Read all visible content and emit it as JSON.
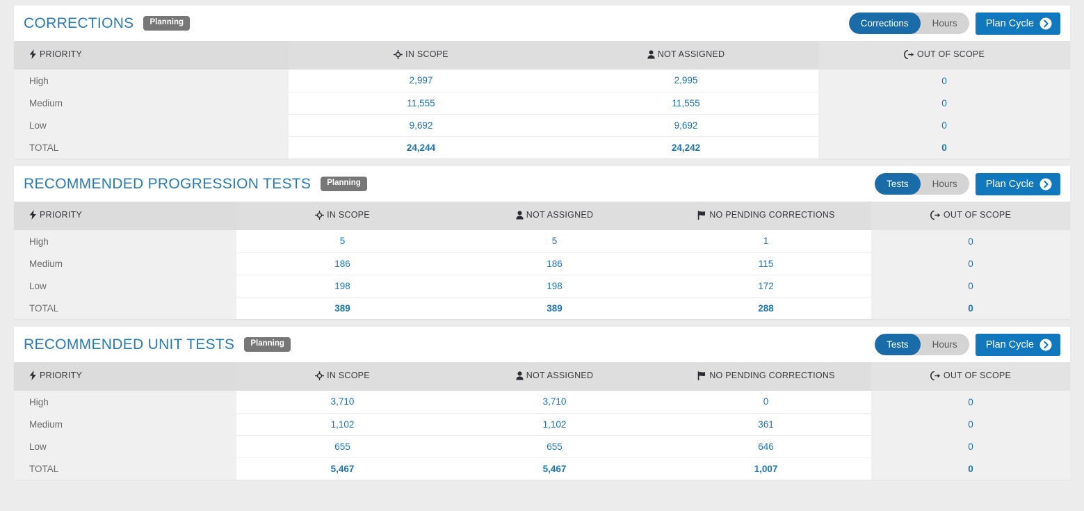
{
  "page": {
    "background_color": "#ececec",
    "accent_blue": "#1278bd",
    "title_blue": "#2a7ab5",
    "value_blue": "#1d73b3",
    "badge_gray": "#777777"
  },
  "column_icons": {
    "priority": "lightning-bolt-icon",
    "in_scope": "crosshair-target-icon",
    "not_assigned": "person-icon",
    "no_pending_corrections": "flag-icon",
    "out_of_scope": "sign-out-icon"
  },
  "sections": [
    {
      "id": "corrections",
      "title": "CORRECTIONS",
      "badge": "Planning",
      "toggle": {
        "options": [
          "Corrections",
          "Hours"
        ],
        "selected": "Corrections"
      },
      "plan_button": "Plan Cycle",
      "columns": [
        "PRIORITY",
        "IN SCOPE",
        "NOT ASSIGNED",
        "OUT OF SCOPE"
      ],
      "rows": [
        {
          "priority": "High",
          "values": [
            "2,997",
            "2,995",
            "0"
          ]
        },
        {
          "priority": "Medium",
          "values": [
            "11,555",
            "11,555",
            "0"
          ]
        },
        {
          "priority": "Low",
          "values": [
            "9,692",
            "9,692",
            "0"
          ]
        },
        {
          "priority": "TOTAL",
          "values": [
            "24,244",
            "24,242",
            "0"
          ]
        }
      ]
    },
    {
      "id": "recommended-progression-tests",
      "title": "RECOMMENDED PROGRESSION TESTS",
      "badge": "Planning",
      "toggle": {
        "options": [
          "Tests",
          "Hours"
        ],
        "selected": "Tests"
      },
      "plan_button": "Plan Cycle",
      "columns": [
        "PRIORITY",
        "IN SCOPE",
        "NOT ASSIGNED",
        "NO PENDING CORRECTIONS",
        "OUT OF SCOPE"
      ],
      "rows": [
        {
          "priority": "High",
          "values": [
            "5",
            "5",
            "1",
            "0"
          ]
        },
        {
          "priority": "Medium",
          "values": [
            "186",
            "186",
            "115",
            "0"
          ]
        },
        {
          "priority": "Low",
          "values": [
            "198",
            "198",
            "172",
            "0"
          ]
        },
        {
          "priority": "TOTAL",
          "values": [
            "389",
            "389",
            "288",
            "0"
          ]
        }
      ]
    },
    {
      "id": "recommended-unit-tests",
      "title": "RECOMMENDED UNIT TESTS",
      "badge": "Planning",
      "toggle": {
        "options": [
          "Tests",
          "Hours"
        ],
        "selected": "Tests"
      },
      "plan_button": "Plan Cycle",
      "columns": [
        "PRIORITY",
        "IN SCOPE",
        "NOT ASSIGNED",
        "NO PENDING CORRECTIONS",
        "OUT OF SCOPE"
      ],
      "rows": [
        {
          "priority": "High",
          "values": [
            "3,710",
            "3,710",
            "0",
            "0"
          ]
        },
        {
          "priority": "Medium",
          "values": [
            "1,102",
            "1,102",
            "361",
            "0"
          ]
        },
        {
          "priority": "Low",
          "values": [
            "655",
            "655",
            "646",
            "0"
          ]
        },
        {
          "priority": "TOTAL",
          "values": [
            "5,467",
            "5,467",
            "1,007",
            "0"
          ]
        }
      ]
    }
  ]
}
